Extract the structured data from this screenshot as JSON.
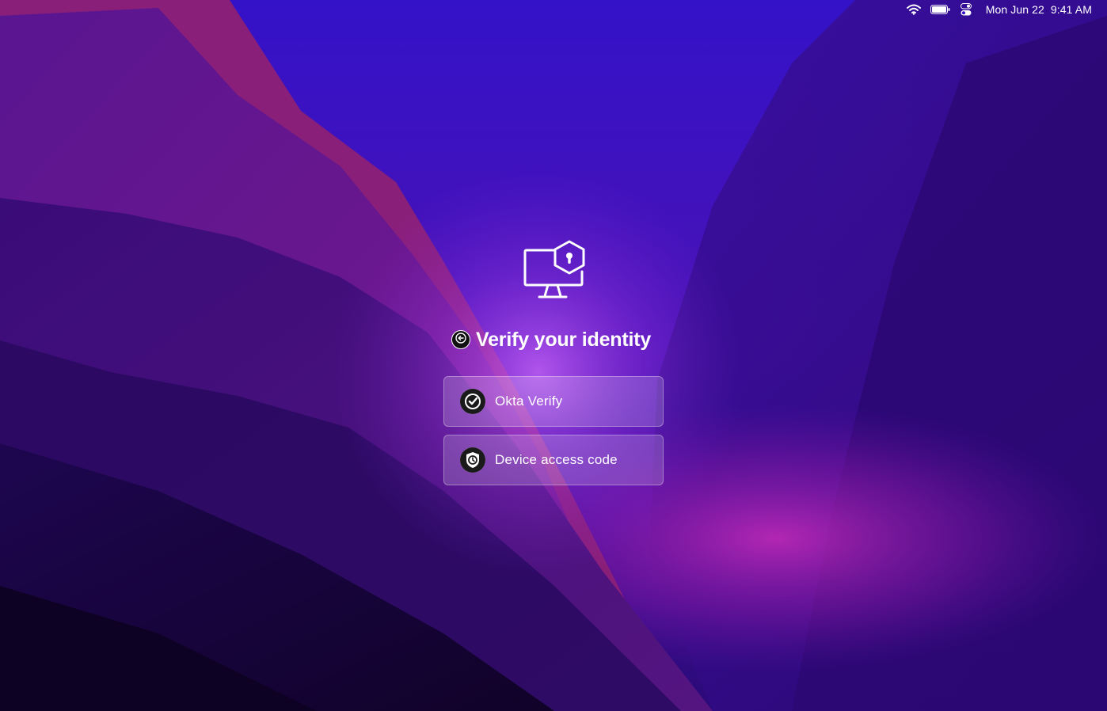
{
  "menubar": {
    "icons": [
      "wifi-icon",
      "battery-icon",
      "control-center-icon"
    ],
    "date": "Mon Jun 22",
    "time": "9:41 AM"
  },
  "auth": {
    "icon": "monitor-lock-icon",
    "title": "Verify your identity",
    "back_icon": "back-arrow-icon",
    "options": [
      {
        "label": "Okta Verify",
        "icon": "okta-verify-icon"
      },
      {
        "label": "Device access code",
        "icon": "shield-clock-icon"
      }
    ]
  },
  "colors": {
    "wallpaper_top": "#3a10b8",
    "wallpaper_dark": "#1a0740",
    "wallpaper_magenta": "#9a1fa8",
    "option_fill": "rgba(255,255,255,0.18)"
  }
}
